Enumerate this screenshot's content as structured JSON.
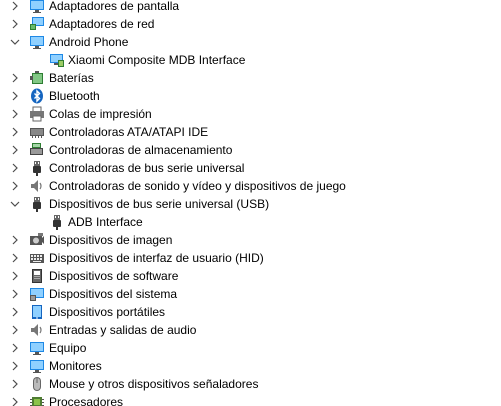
{
  "device_tree": {
    "items": [
      {
        "label": "Adaptadores de pantalla",
        "icon": "monitor-icon",
        "expanded": false
      },
      {
        "label": "Adaptadores de red",
        "icon": "network-adapter-icon",
        "expanded": false
      },
      {
        "label": "Android Phone",
        "icon": "phone-monitor-icon",
        "expanded": true,
        "children": [
          {
            "label": "Xiaomi Composite MDB Interface",
            "icon": "mdb-interface-icon"
          }
        ]
      },
      {
        "label": "Baterías",
        "icon": "battery-icon",
        "expanded": false
      },
      {
        "label": "Bluetooth",
        "icon": "bluetooth-icon",
        "expanded": false
      },
      {
        "label": "Colas de impresión",
        "icon": "printer-icon",
        "expanded": false
      },
      {
        "label": "Controladoras ATA/ATAPI IDE",
        "icon": "ide-controller-icon",
        "expanded": false
      },
      {
        "label": "Controladoras de almacenamiento",
        "icon": "storage-controller-icon",
        "expanded": false
      },
      {
        "label": "Controladoras de bus serie universal",
        "icon": "usb-icon",
        "expanded": false
      },
      {
        "label": "Controladoras de sonido y vídeo y dispositivos de juego",
        "icon": "speaker-icon",
        "expanded": false
      },
      {
        "label": "Dispositivos de bus serie universal (USB)",
        "icon": "usb-icon",
        "expanded": true,
        "children": [
          {
            "label": "ADB Interface",
            "icon": "usb-icon"
          }
        ]
      },
      {
        "label": "Dispositivos de imagen",
        "icon": "camera-icon",
        "expanded": false
      },
      {
        "label": "Dispositivos de interfaz de usuario (HID)",
        "icon": "keyboard-icon",
        "expanded": false
      },
      {
        "label": "Dispositivos de software",
        "icon": "software-device-icon",
        "expanded": false
      },
      {
        "label": "Dispositivos del sistema",
        "icon": "system-device-icon",
        "expanded": false
      },
      {
        "label": "Dispositivos portátiles",
        "icon": "portable-device-icon",
        "expanded": false
      },
      {
        "label": "Entradas y salidas de audio",
        "icon": "speaker-icon",
        "expanded": false
      },
      {
        "label": "Equipo",
        "icon": "computer-icon",
        "expanded": false
      },
      {
        "label": "Monitores",
        "icon": "monitor-icon",
        "expanded": false
      },
      {
        "label": "Mouse y otros dispositivos señaladores",
        "icon": "mouse-icon",
        "expanded": false
      },
      {
        "label": "Procesadores",
        "icon": "processor-icon",
        "expanded": false
      }
    ]
  },
  "colors": {
    "text": "#000000",
    "chevron": "#4d4d4d",
    "monitor_blue": "#1e88e5",
    "screen_light": "#8fd0ff",
    "gray_icon": "#6e6e6e",
    "green_icon": "#2e7d32"
  }
}
